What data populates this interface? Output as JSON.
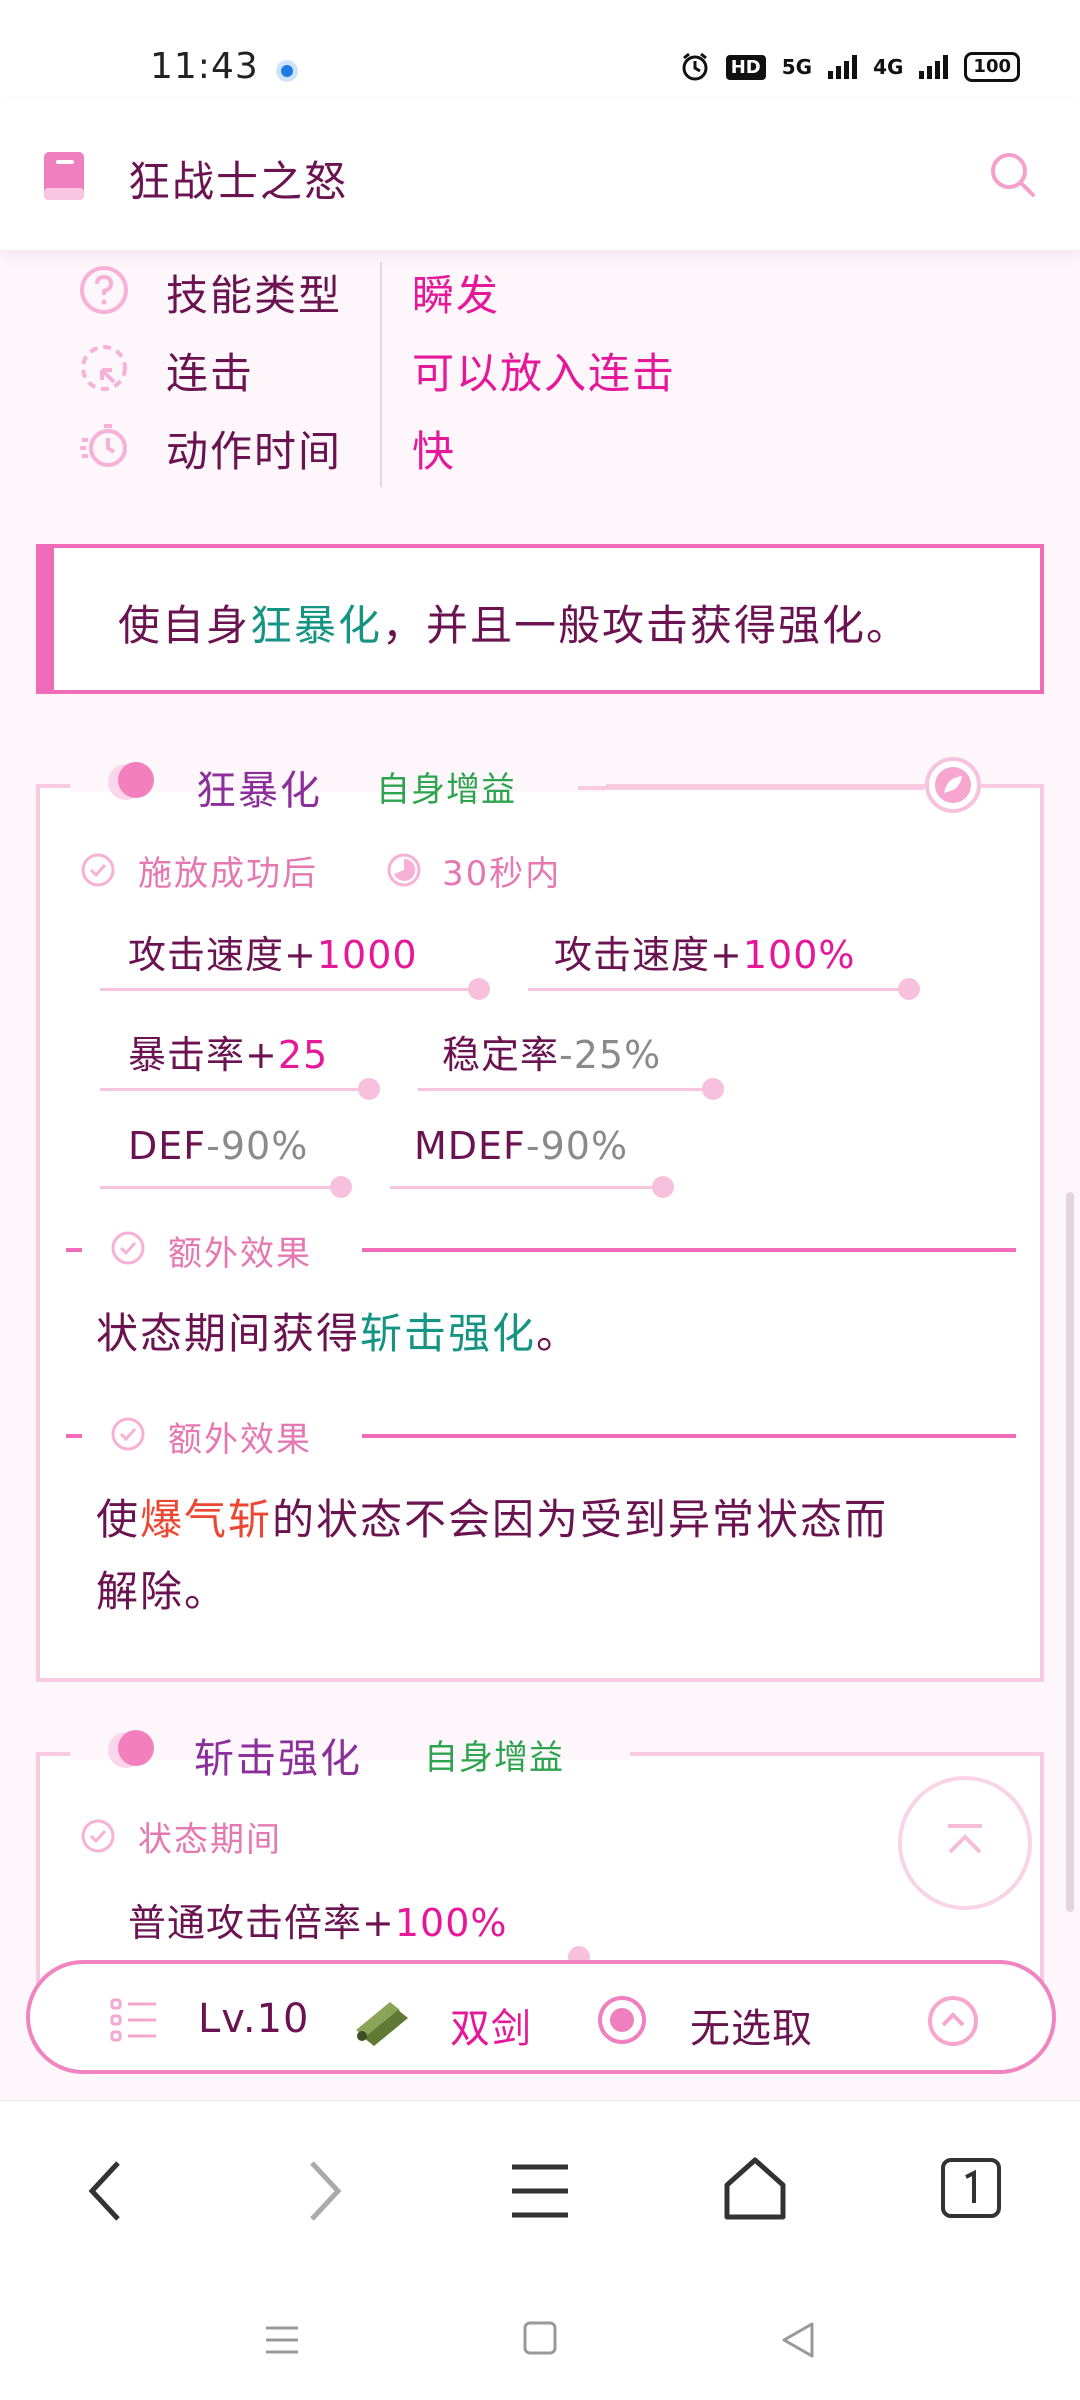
{
  "status_bar": {
    "time": "11:43",
    "hd_label": "HD",
    "net1": "5G",
    "net2": "4G",
    "battery": "100"
  },
  "header": {
    "title": "狂战士之怒",
    "book_icon": "book-icon",
    "search_icon": "search-icon"
  },
  "info": [
    {
      "icon": "question-icon",
      "label": "技能类型",
      "value": "瞬发"
    },
    {
      "icon": "combo-icon",
      "label": "连击",
      "value": "可以放入连击"
    },
    {
      "icon": "timer-icon",
      "label": "动作时间",
      "value": "快"
    }
  ],
  "summary": {
    "prefix": "使自身",
    "highlight": "狂暴化",
    "suffix": "，并且一般攻击获得强化。"
  },
  "buff1": {
    "name": "狂暴化",
    "tag": "自身增益",
    "condition": "施放成功后",
    "duration": "30秒内",
    "stats": [
      {
        "label": "攻击速度+",
        "value": "1000"
      },
      {
        "label": "攻击速度+",
        "value": "100%"
      },
      {
        "label": "暴击率+",
        "value": "25"
      },
      {
        "label": "稳定率",
        "value": "-25%"
      },
      {
        "label": "DEF",
        "value": "-90%"
      },
      {
        "label": "MDEF",
        "value": "-90%"
      }
    ],
    "extra1": {
      "label": "额外效果",
      "prefix": "状态期间获得",
      "highlight": "斩击强化",
      "suffix": "。"
    },
    "extra2": {
      "label": "额外效果",
      "prefix": "使",
      "highlight": "爆气斩",
      "suffix_line1": "的状态不会因为受到异常状态而",
      "line2": "解除。"
    }
  },
  "buff2": {
    "name": "斩击强化",
    "tag": "自身增益",
    "condition": "状态期间",
    "stat_label": "普通攻击倍率+",
    "stat_value": "100%"
  },
  "control_bar": {
    "level": "Lv.10",
    "weapon": "双剑",
    "target": "无选取"
  },
  "colors": {
    "accent_pink": "#e5189a",
    "border_pink": "#f06cb8",
    "text_purple": "#6b1250",
    "teal": "#159383",
    "red": "#ec4733",
    "green": "#2fa44f"
  }
}
